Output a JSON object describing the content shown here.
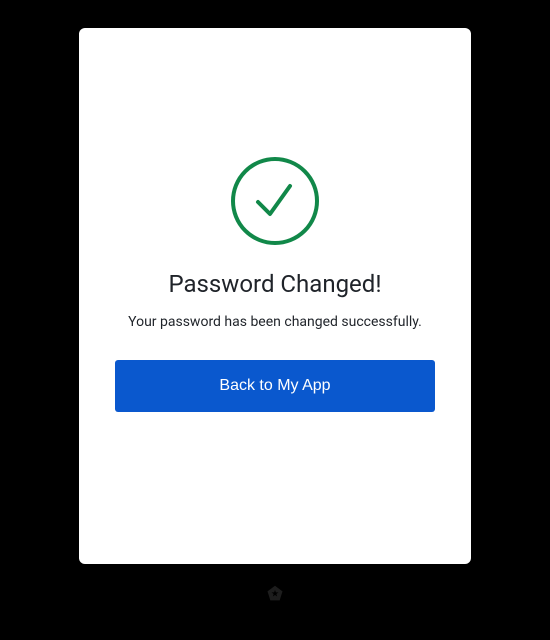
{
  "card": {
    "title": "Password Changed!",
    "subtitle": "Your password has been changed successfully.",
    "button_label": "Back to My App"
  },
  "colors": {
    "success": "#118849",
    "primary": "#0a58ce"
  }
}
